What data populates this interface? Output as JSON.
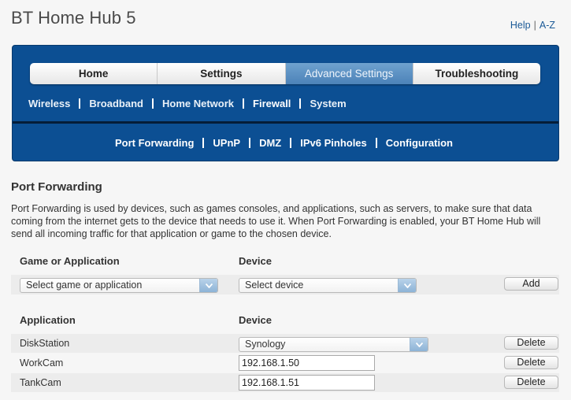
{
  "header": {
    "title": "BT Home Hub 5",
    "help": "Help",
    "az": "A-Z"
  },
  "tabs": [
    {
      "label": "Home"
    },
    {
      "label": "Settings"
    },
    {
      "label": "Advanced Settings"
    },
    {
      "label": "Troubleshooting"
    }
  ],
  "subnav": [
    "Wireless",
    "Broadband",
    "Home Network",
    "Firewall",
    "System"
  ],
  "subnav_current": "Firewall",
  "subnav2": [
    "Port Forwarding",
    "UPnP",
    "DMZ",
    "IPv6 Pinholes",
    "Configuration"
  ],
  "subnav2_current": "Port Forwarding",
  "section": {
    "title": "Port Forwarding",
    "description": "Port Forwarding is used by devices, such as games consoles, and applications, such as servers, to make sure that data coming from the internet gets to the device that needs to use it. When Port Forwarding is enabled, your BT Home Hub will send all incoming traffic for that application or game to the chosen device."
  },
  "add_form": {
    "col_app": "Game or Application",
    "col_device": "Device",
    "app_select": "Select game or application",
    "device_select": "Select device",
    "add_label": "Add"
  },
  "table": {
    "col_app": "Application",
    "col_device": "Device",
    "delete_label": "Delete",
    "rows": [
      {
        "app": "DiskStation",
        "device": "Synology",
        "type": "select"
      },
      {
        "app": "WorkCam",
        "device": "192.168.1.50",
        "type": "input"
      },
      {
        "app": "TankCam",
        "device": "192.168.1.51",
        "type": "input"
      }
    ]
  }
}
